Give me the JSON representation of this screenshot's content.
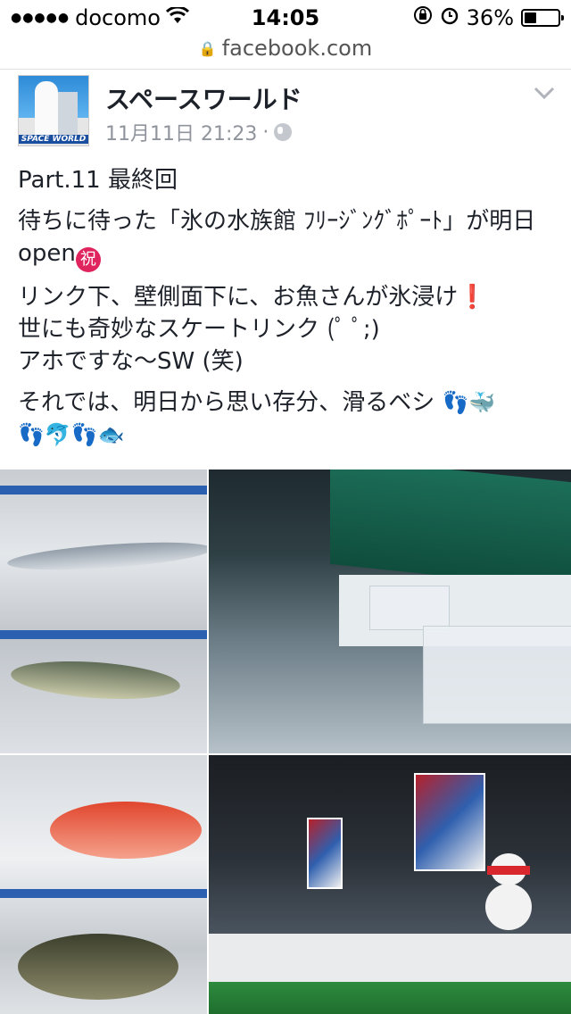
{
  "status_bar": {
    "carrier": "docomo",
    "time": "14:05",
    "battery": "36%",
    "battery_level": 0.36
  },
  "url_bar": {
    "domain": "facebook.com"
  },
  "post": {
    "page_name": "スペースワールド",
    "avatar_text": "SPACE WORLD",
    "timestamp": "11月11日 21:23",
    "separator": "·",
    "lines": {
      "p1": "Part.11 最終回",
      "p2": "待ちに待った「氷の水族館 ﾌﾘｰｼﾞﾝｸﾞﾎﾟｰﾄ」が明日open",
      "p3a": "リンク下、壁側面下に、お魚さんが氷浸け",
      "p3b": "世にも奇妙なスケートリンク (ﾟ ﾟ;)",
      "p3c": "アホですな〜SW (笑)",
      "p4": "それでは、明日から思い存分、滑るベシ"
    },
    "emoji": {
      "celebrate": "祝",
      "exclamation": "❗",
      "feet": "👣",
      "whale": "🐳",
      "dolphin": "🐬",
      "fish": "🐟"
    }
  },
  "icons": [
    "signal-dots-icon",
    "wifi-icon",
    "rotation-lock-icon",
    "alarm-icon",
    "battery-icon",
    "lock-icon",
    "globe-icon",
    "chevron-down-icon"
  ],
  "colors": {
    "text": "#1d2129",
    "meta": "#90949c",
    "celebrate_badge": "#e0245e",
    "exclamation": "#d0021b"
  }
}
